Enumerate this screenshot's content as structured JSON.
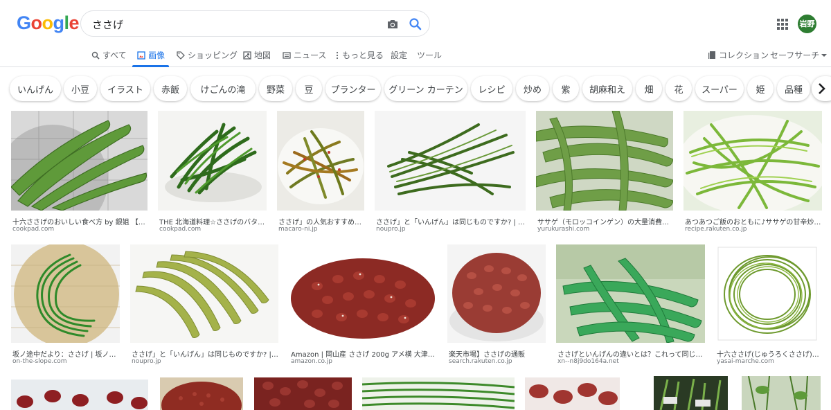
{
  "search": {
    "query": "ささげ"
  },
  "header": {
    "logo": "Google",
    "avatar_text": "岩野"
  },
  "nav": {
    "all": "すべて",
    "images": "画像",
    "shopping": "ショッピング",
    "maps": "地図",
    "news": "ニュース",
    "more": "もっと見る",
    "settings": "設定",
    "tools": "ツール",
    "collections": "コレクション",
    "safesearch": "セーフサーチ"
  },
  "chips": [
    "いんげん",
    "小豆",
    "イラスト",
    "赤飯",
    "けごんの滝",
    "野菜",
    "豆",
    "プランター",
    "グリーン カーテン",
    "レシピ",
    "炒め",
    "紫",
    "胡麻和え",
    "畑",
    "花",
    "スーパー",
    "姫",
    "品種"
  ],
  "results_row1": [
    {
      "title": "十六ささげのおいしい食べ方 by 銀姐 【…",
      "source": "cookpad.com"
    },
    {
      "title": "THE 北海道料理☆ささげのバター…",
      "source": "cookpad.com"
    },
    {
      "title": "ささげ」の人気おすすめ…",
      "source": "macaro-ni.jp"
    },
    {
      "title": "ささげ」と「いんげん」は同じものですか? | …",
      "source": "noupro.jp"
    },
    {
      "title": "ササゲ（モロッコインゲン）の大量消費…",
      "source": "yurukurashi.com"
    },
    {
      "title": "あつあつご飯のおともに♪ササゲの甘辛炒…",
      "source": "recipe.rakuten.co.jp"
    }
  ],
  "results_row2": [
    {
      "title": "坂ノ途中だより：ささげ | 坂ノ…",
      "source": "on-the-slope.com"
    },
    {
      "title": "ささげ」と「いんげん」は同じものですか? | …",
      "source": "noupro.jp"
    },
    {
      "title": "Amazon | 岡山産 ささげ 200g アメ横 大津屋 …",
      "source": "amazon.co.jp"
    },
    {
      "title": "楽天市場】ささげの通販",
      "source": "search.rakuten.co.jp"
    },
    {
      "title": "ささげといんげんの違いとは？これって同じ…",
      "source": "xn--n8j9do164a.net"
    },
    {
      "title": "十六ささげ(じゅうろくささげ)…",
      "source": "yasai-marche.com"
    }
  ],
  "colors": {
    "accent": "#1a73e8",
    "logo_blue": "#4285f4",
    "logo_red": "#ea4335",
    "logo_yellow": "#fbbc05",
    "logo_green": "#34a853",
    "avatar_bg": "#2e7d32"
  }
}
